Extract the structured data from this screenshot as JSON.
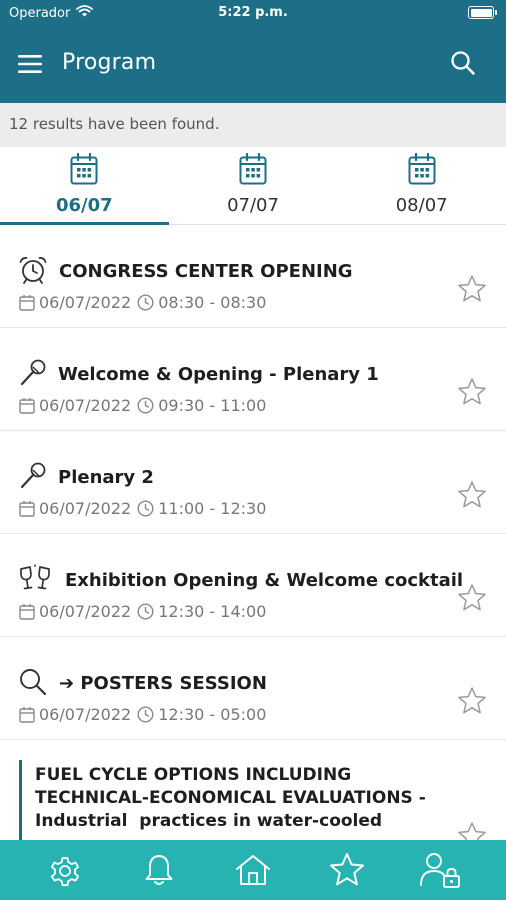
{
  "status_bar": {
    "carrier": "Operador",
    "time": "5:22 p.m.",
    "battery_level": 1.0
  },
  "header": {
    "title": "Program",
    "menu_icon": "hamburger-menu-icon",
    "search_icon": "search-icon"
  },
  "results_text": "12 results have been found.",
  "tabs": [
    {
      "label": "06/07",
      "active": true
    },
    {
      "label": "07/07",
      "active": false
    },
    {
      "label": "08/07",
      "active": false
    }
  ],
  "items": [
    {
      "title": "CONGRESS CENTER OPENING",
      "icon": "alarm-clock-icon",
      "date": "06/07/2022",
      "time": "08:30 - 08:30"
    },
    {
      "title": "Welcome & Opening - Plenary 1",
      "icon": "microphone-icon",
      "date": "06/07/2022",
      "time": "09:30 - 11:00"
    },
    {
      "title": "Plenary 2",
      "icon": "microphone-icon",
      "date": "06/07/2022",
      "time": "11:00 - 12:30"
    },
    {
      "title": "Exhibition Opening & Welcome cocktail",
      "icon": "cocktail-glasses-icon",
      "date": "06/07/2022",
      "time": "12:30 - 14:00"
    },
    {
      "title": "➔ POSTERS SESSION",
      "icon": "magnifier-icon",
      "date": "06/07/2022",
      "time": "12:30 - 05:00"
    }
  ],
  "featured_item": {
    "title_lines": [
      "FUEL CYCLE OPTIONS INCLUDING",
      "TECHNICAL-ECONOMICAL EVALUATIONS -",
      "Industrial  practices in water-cooled"
    ]
  },
  "bottom_nav": [
    {
      "icon": "settings-gear-icon"
    },
    {
      "icon": "notification-bell-icon"
    },
    {
      "icon": "home-icon"
    },
    {
      "icon": "favorites-star-icon"
    },
    {
      "icon": "user-lock-icon"
    }
  ],
  "colors": {
    "primary": "#1d6f87",
    "accent": "#26b3b1",
    "results_bg": "#ececec"
  }
}
